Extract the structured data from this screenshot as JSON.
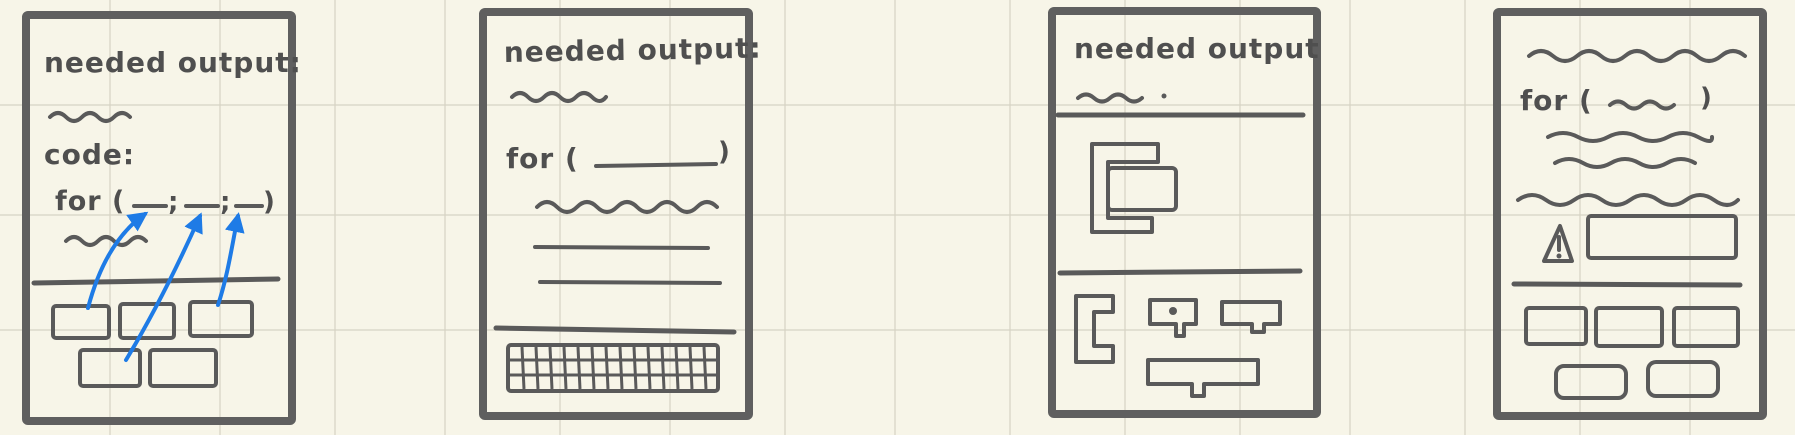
{
  "colors": {
    "background": "#f7f5e8",
    "grid": "#d6d3c4",
    "ink": "#5a5a5a",
    "accent": "#1e7be6"
  },
  "frames": [
    {
      "heading": "needed output:",
      "code_label": "code:",
      "code_line_prefix": "for (",
      "code_line_separators": [
        ";",
        ";"
      ],
      "code_line_suffix": ")"
    },
    {
      "heading": "needed output:",
      "code_line_prefix": "for (",
      "code_line_suffix": ")"
    },
    {
      "heading": "needed output"
    },
    {
      "code_line_prefix": "for (",
      "code_line_suffix": ")",
      "warning_icon": "warning-triangle-icon"
    }
  ]
}
